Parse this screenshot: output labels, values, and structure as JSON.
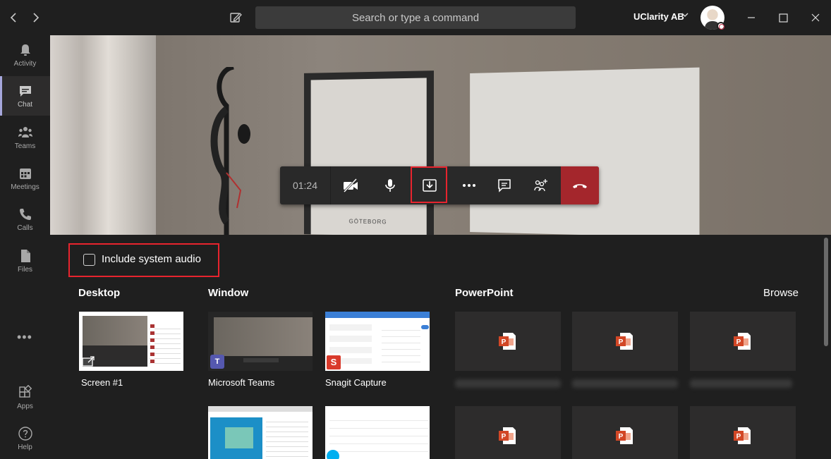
{
  "titlebar": {
    "search_placeholder": "Search or type a command",
    "org_name": "UClarity AB",
    "back_icon": "chevron-left-icon",
    "forward_icon": "chevron-right-icon"
  },
  "rail": {
    "items": [
      {
        "label": "Activity",
        "icon": "bell-icon"
      },
      {
        "label": "Chat",
        "icon": "chat-icon"
      },
      {
        "label": "Teams",
        "icon": "teams-icon"
      },
      {
        "label": "Meetings",
        "icon": "calendar-icon"
      },
      {
        "label": "Calls",
        "icon": "phone-icon"
      },
      {
        "label": "Files",
        "icon": "file-icon"
      }
    ],
    "more": "•••",
    "apps_label": "Apps",
    "help_label": "Help"
  },
  "video": {
    "poster_caption": "GÖTEBORG"
  },
  "callbar": {
    "timer": "01:24"
  },
  "share": {
    "include_audio_label": "Include system audio",
    "desktop_title": "Desktop",
    "window_title": "Window",
    "powerpoint_title": "PowerPoint",
    "browse_label": "Browse",
    "screens": [
      {
        "label": "Screen #1"
      }
    ],
    "windows": [
      {
        "label": "Microsoft Teams"
      },
      {
        "label": "Snagit Capture"
      }
    ]
  },
  "colors": {
    "accent": "#a6a7dc",
    "hangup": "#a4262c",
    "highlight": "#e8242e",
    "powerpoint": "#d24726"
  }
}
